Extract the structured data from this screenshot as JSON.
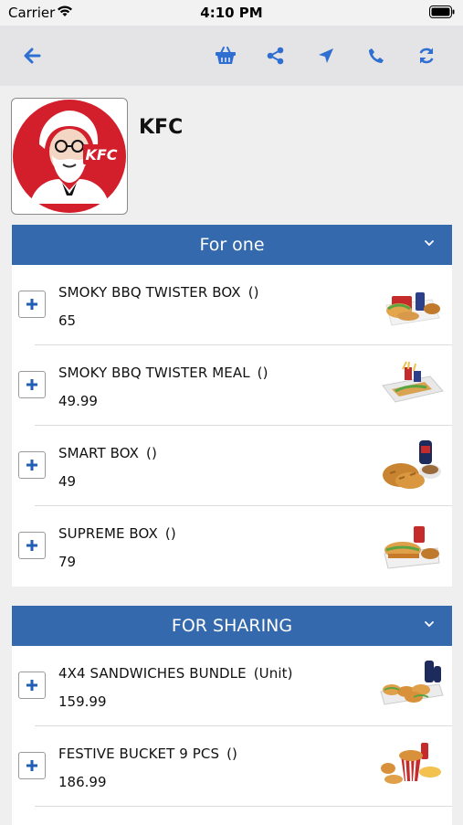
{
  "status": {
    "carrier": "Carrier",
    "time": "4:10 PM"
  },
  "toolbar": {
    "icons": [
      "back-arrow-icon",
      "basket-icon",
      "share-icon",
      "location-arrow-icon",
      "phone-icon",
      "refresh-icon"
    ],
    "accent": "#2f6fd1"
  },
  "store": {
    "name": "KFC",
    "logo_text": "KFC"
  },
  "sections": [
    {
      "title": "For one",
      "items": [
        {
          "name": "SMOKY BBQ TWISTER BOX",
          "unit": "()",
          "price": "65"
        },
        {
          "name": "SMOKY BBQ TWISTER MEAL",
          "unit": "()",
          "price": "49.99"
        },
        {
          "name": "SMART BOX",
          "unit": "()",
          "price": "49"
        },
        {
          "name": "SUPREME BOX",
          "unit": "()",
          "price": "79"
        }
      ]
    },
    {
      "title": "FOR SHARING",
      "items": [
        {
          "name": "4X4 SANDWICHES BUNDLE",
          "unit": "(Unit)",
          "price": "159.99"
        },
        {
          "name": "FESTIVE BUCKET 9 PCS",
          "unit": "()",
          "price": "186.99"
        }
      ]
    }
  ],
  "colors": {
    "section_header": "#3469ad",
    "kfc_red": "#d21f2b"
  }
}
